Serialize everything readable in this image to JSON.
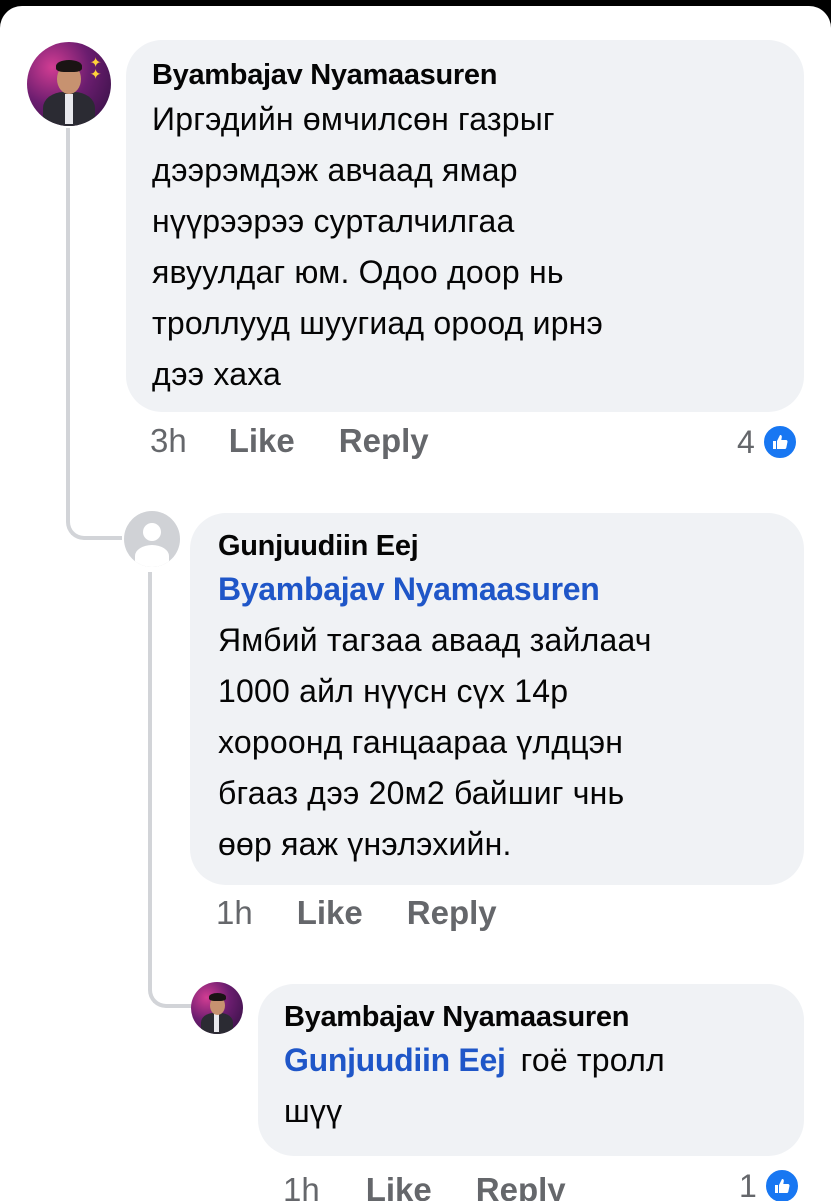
{
  "comments": [
    {
      "author": "Byambajav Nyamaasuren",
      "lines": [
        "Иргэдийн өмчилсөн газрыг",
        "дээрэмдэж авчаад ямар",
        "нүүрээрээ сурталчилгаа",
        "явуулдаг юм. Одоо доор нь",
        "троллууд шуугиад ороод ирнэ",
        "дээ хаха"
      ],
      "time": "3h",
      "like_label": "Like",
      "reply_label": "Reply",
      "reaction_count": "4",
      "reaction_icon": "thumbs-up-icon"
    },
    {
      "author": "Gunjuudiin Eej",
      "mention": "Byambajav Nyamaasuren",
      "lines": [
        "Ямбий тагзаа аваад зайлаач",
        "1000 айл нүүсн сүх 14р",
        "хороонд ганцаараа үлдцэн",
        "бгааз дээ 20м2 байшиг чнь",
        "өөр яаж үнэлэхийн."
      ],
      "time": "1h",
      "like_label": "Like",
      "reply_label": "Reply"
    },
    {
      "author": "Byambajav Nyamaasuren",
      "mention": "Gunjuudiin Eej",
      "lines": [
        "гоё тролл",
        "шүү"
      ],
      "time": "1h",
      "like_label": "Like",
      "reply_label": "Reply",
      "reaction_count": "1",
      "reaction_icon": "thumbs-up-icon"
    }
  ],
  "colors": {
    "bubble": "#f0f2f5",
    "text": "#050505",
    "meta": "#65676b",
    "mention": "#1f56c8",
    "like_badge": "#1877f2"
  }
}
